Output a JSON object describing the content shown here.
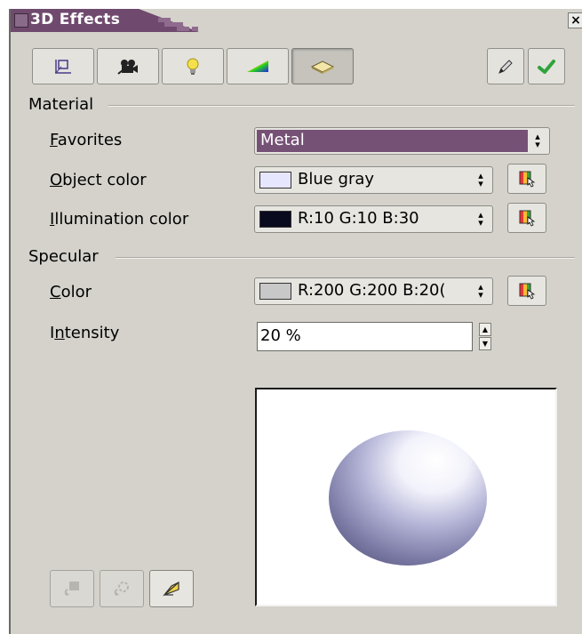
{
  "window": {
    "title": "3D Effects",
    "close_glyph": "×"
  },
  "toolbar": {
    "tabs": [
      {
        "name": "geometry",
        "icon": "geometry-icon",
        "active": false
      },
      {
        "name": "shading",
        "icon": "camera-icon",
        "active": false
      },
      {
        "name": "illumination",
        "icon": "light-bulb-icon",
        "active": false
      },
      {
        "name": "textures",
        "icon": "texture-gradient-icon",
        "active": false
      },
      {
        "name": "material",
        "icon": "material-icon",
        "active": true
      }
    ],
    "right_buttons": [
      {
        "name": "update",
        "icon": "pencil-icon"
      },
      {
        "name": "assign",
        "icon": "checkmark-icon"
      }
    ]
  },
  "material": {
    "section_label": "Material",
    "favorites": {
      "label_pre": "",
      "label_ul": "F",
      "label_post": "avorites",
      "value": "Metal",
      "highlight": "#765176"
    },
    "object_color": {
      "label_pre": "",
      "label_ul": "O",
      "label_post": "bject color",
      "value": "Blue gray",
      "swatch": "#e6e6ff"
    },
    "illumination_color": {
      "label_pre": "",
      "label_ul": "I",
      "label_post": "llumination color",
      "value": "R:10 G:10 B:30",
      "swatch": "#0a0a1e"
    }
  },
  "specular": {
    "section_label": "Specular",
    "color": {
      "label_pre": "",
      "label_ul": "C",
      "label_post": "olor",
      "value": "R:200 G:200 B:20(",
      "swatch": "#c8c8c8"
    },
    "intensity": {
      "label_pre": "I",
      "label_ul": "n",
      "label_post": "tensity",
      "value": "20 %"
    }
  },
  "bottom_buttons": [
    {
      "name": "convert-to-3d",
      "icon": "convert-3d-icon",
      "enabled": false
    },
    {
      "name": "convert-to-lathe",
      "icon": "lathe-icon",
      "enabled": false
    },
    {
      "name": "perspective",
      "icon": "perspective-icon",
      "enabled": true
    }
  ],
  "colors": {
    "window_bg": "#d4d2cb",
    "title_bar": "#6f4a6e",
    "favorites_highlight": "#765176",
    "sphere_tint": "#9a9ac8"
  }
}
